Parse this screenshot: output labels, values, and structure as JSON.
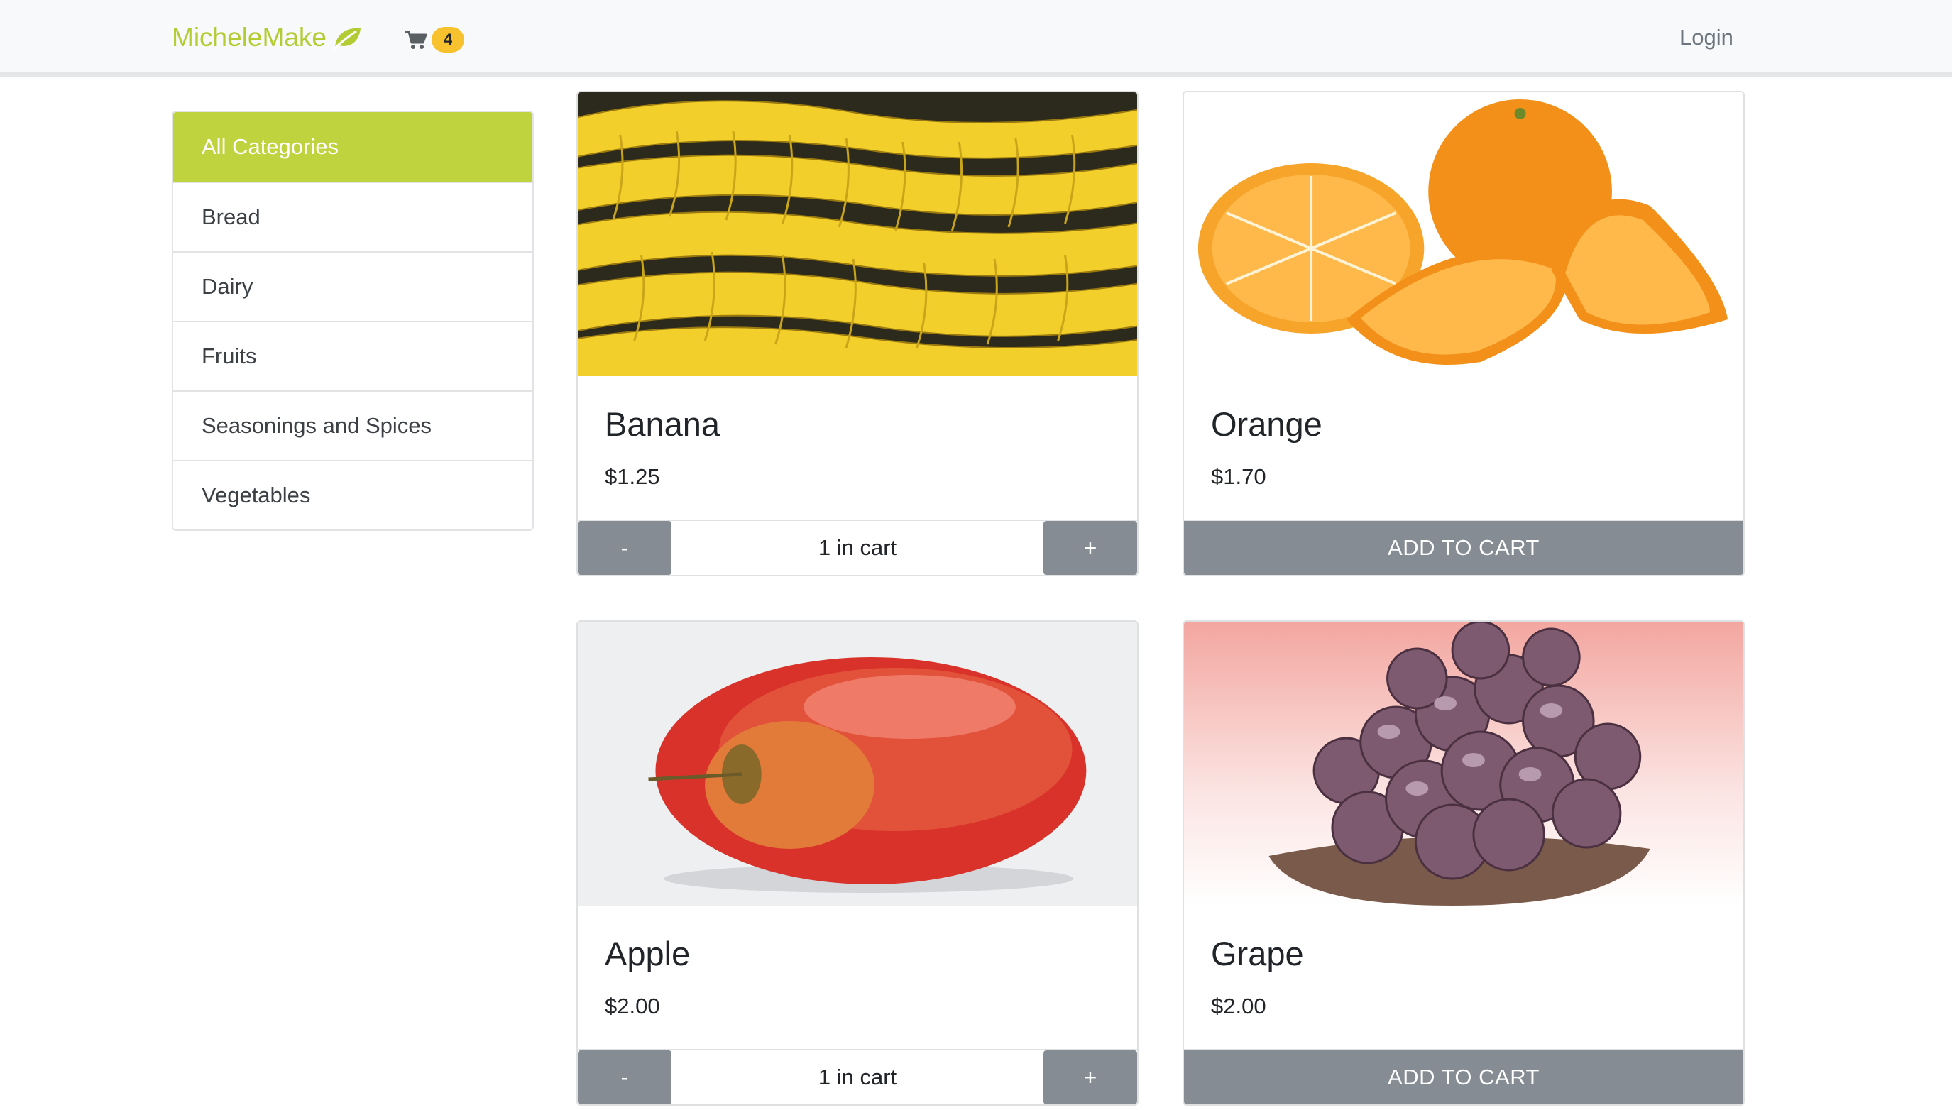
{
  "navbar": {
    "brand": "MicheleMake",
    "brand_color": "#b4cc33",
    "cart_count": "4",
    "login_label": "Login"
  },
  "sidebar": {
    "items": [
      {
        "label": "All Categories",
        "active": true
      },
      {
        "label": "Bread"
      },
      {
        "label": "Dairy"
      },
      {
        "label": "Fruits"
      },
      {
        "label": "Seasonings and Spices"
      },
      {
        "label": "Vegetables"
      }
    ]
  },
  "products": [
    {
      "name": "Banana",
      "price": "$1.25",
      "in_cart": "1 in cart",
      "minus": "-",
      "plus": "+",
      "image": "banana-bunches"
    },
    {
      "name": "Orange",
      "price": "$1.70",
      "add_label": "ADD TO CART",
      "image": "orange-slices"
    },
    {
      "name": "Apple",
      "price": "$2.00",
      "in_cart": "1 in cart",
      "minus": "-",
      "plus": "+",
      "image": "red-apple"
    },
    {
      "name": "Grape",
      "price": "$2.00",
      "add_label": "ADD TO CART",
      "image": "grape-cluster"
    }
  ],
  "colors": {
    "accent": "#bfd33f",
    "badge": "#f7c22e",
    "button": "#858c93"
  }
}
